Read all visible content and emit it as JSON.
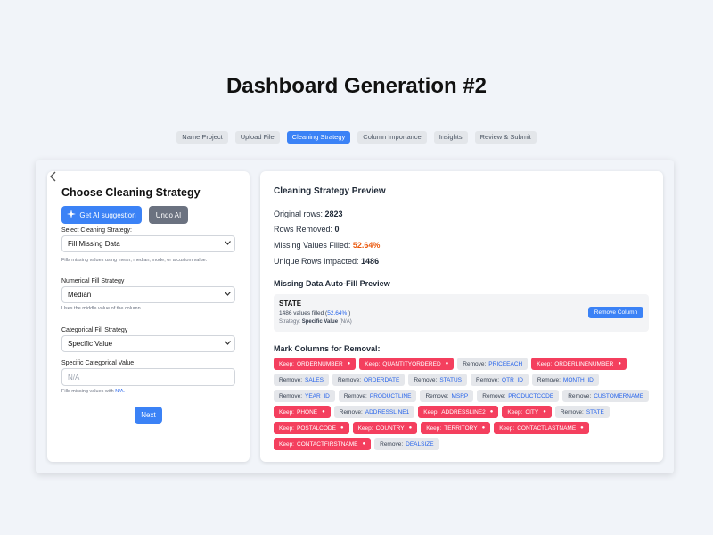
{
  "page_title": "Dashboard Generation #2",
  "steps": [
    "Name Project",
    "Upload File",
    "Cleaning Strategy",
    "Column Importance",
    "Insights",
    "Review & Submit"
  ],
  "active_step": 2,
  "left": {
    "back_icon": "chevron-left-icon",
    "title": "Choose Cleaning Strategy",
    "ai_button": "Get AI suggestion",
    "undo_button": "Undo AI",
    "cleaning_label": "Select Cleaning Strategy:",
    "cleaning_value": "Fill Missing Data",
    "cleaning_help": "Fills missing values using mean, median, mode, or a custom value.",
    "numerical_label": "Numerical Fill Strategy",
    "numerical_value": "Median",
    "numerical_help": "Uses the middle value of the column.",
    "categorical_label": "Categorical Fill Strategy",
    "categorical_value": "Specific Value",
    "specific_label": "Specific Categorical Value",
    "specific_placeholder": "N/A",
    "specific_help_prefix": "Fills missing values with ",
    "specific_help_value": "N/A.",
    "next_button": "Next"
  },
  "right": {
    "title": "Cleaning Strategy Preview",
    "original_rows_label": "Original rows: ",
    "original_rows": "2823",
    "rows_removed_label": "Rows Removed: ",
    "rows_removed": "0",
    "missing_filled_label": "Missing Values Filled: ",
    "missing_filled": "52.64%",
    "unique_rows_label": "Unique Rows Impacted: ",
    "unique_rows": "1486",
    "autofill_title": "Missing Data Auto-Fill Preview",
    "preview": {
      "column": "STATE",
      "filled_count": "1486",
      "filled_text": " values filled (",
      "filled_pct": "52.64%",
      "filled_close": " )",
      "strategy_label": "Strategy: ",
      "strategy_value": "Specific Value",
      "strategy_extra": " (N/A)",
      "remove_button": "Remove Column"
    },
    "mark_title": "Mark Columns for Removal:",
    "columns": [
      {
        "action": "Keep:",
        "name": "ORDERNUMBER",
        "keep": true
      },
      {
        "action": "Keep:",
        "name": "QUANTITYORDERED",
        "keep": true
      },
      {
        "action": "Remove:",
        "name": "PRICEEACH",
        "keep": false
      },
      {
        "action": "Keep:",
        "name": "ORDERLINENUMBER",
        "keep": true
      },
      {
        "action": "Remove:",
        "name": "SALES",
        "keep": false
      },
      {
        "action": "Remove:",
        "name": "ORDERDATE",
        "keep": false
      },
      {
        "action": "Remove:",
        "name": "STATUS",
        "keep": false
      },
      {
        "action": "Remove:",
        "name": "QTR_ID",
        "keep": false
      },
      {
        "action": "Remove:",
        "name": "MONTH_ID",
        "keep": false
      },
      {
        "action": "Remove:",
        "name": "YEAR_ID",
        "keep": false
      },
      {
        "action": "Remove:",
        "name": "PRODUCTLINE",
        "keep": false
      },
      {
        "action": "Remove:",
        "name": "MSRP",
        "keep": false
      },
      {
        "action": "Remove:",
        "name": "PRODUCTCODE",
        "keep": false
      },
      {
        "action": "Remove:",
        "name": "CUSTOMERNAME",
        "keep": false
      },
      {
        "action": "Keep:",
        "name": "PHONE",
        "keep": true
      },
      {
        "action": "Remove:",
        "name": "ADDRESSLINE1",
        "keep": false
      },
      {
        "action": "Keep:",
        "name": "ADDRESSLINE2",
        "keep": true
      },
      {
        "action": "Keep:",
        "name": "CITY",
        "keep": true
      },
      {
        "action": "Remove:",
        "name": "STATE",
        "keep": false
      },
      {
        "action": "Keep:",
        "name": "POSTALCODE",
        "keep": true
      },
      {
        "action": "Keep:",
        "name": "COUNTRY",
        "keep": true
      },
      {
        "action": "Keep:",
        "name": "TERRITORY",
        "keep": true
      },
      {
        "action": "Keep:",
        "name": "CONTACTLASTNAME",
        "keep": true
      },
      {
        "action": "Keep:",
        "name": "CONTACTFIRSTNAME",
        "keep": true
      },
      {
        "action": "Remove:",
        "name": "DEALSIZE",
        "keep": false
      }
    ]
  },
  "colors": {
    "accent": "#3b82f6",
    "keep": "#f43f5e",
    "remove_bg": "#e5e7eb",
    "highlight_orange": "#ea580c"
  }
}
